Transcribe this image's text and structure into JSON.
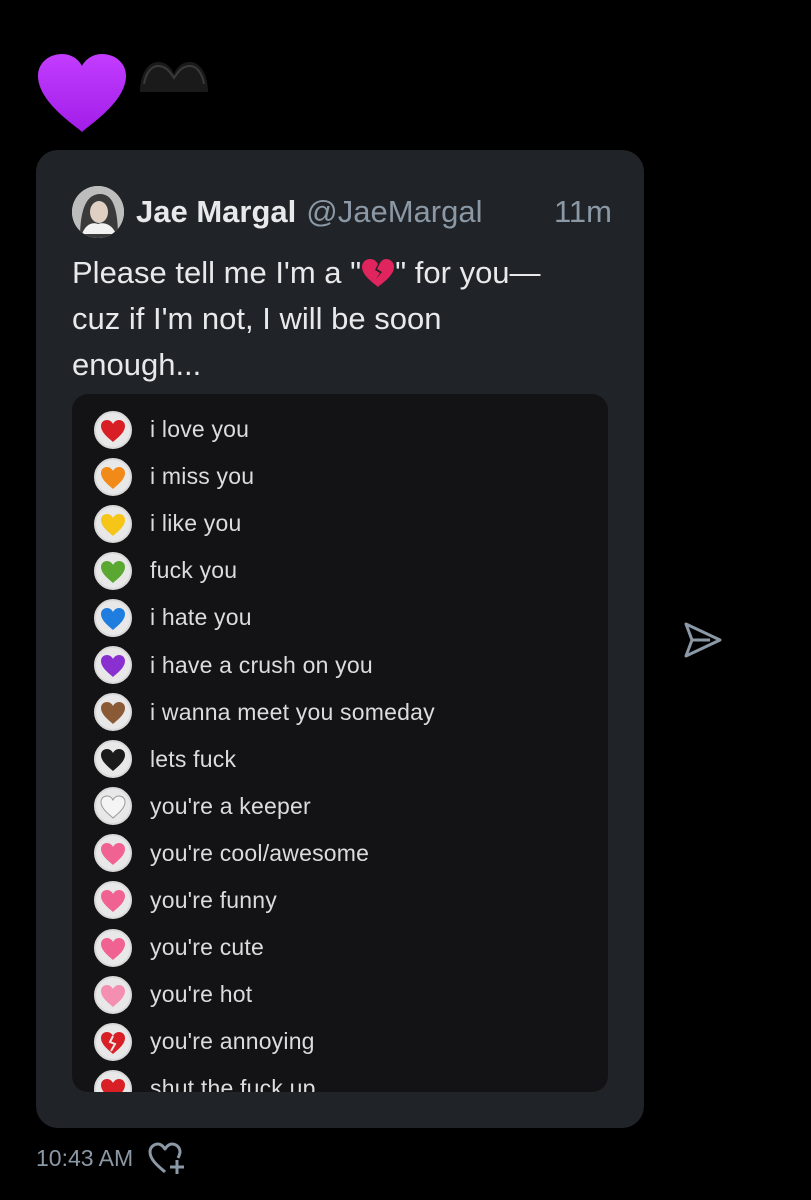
{
  "reactions": [
    {
      "icon": "purple-heart-icon",
      "color": "#b02cf5"
    },
    {
      "icon": "black-heart-icon",
      "color": "#222222"
    }
  ],
  "quoted_tweet": {
    "author": {
      "display_name": "Jae Margal",
      "handle": "@JaeMargal",
      "avatar_icon": "avatar-photo"
    },
    "time_ago": "11m",
    "text_lines": [
      "Please tell me I'm a \"",
      "\" for you—",
      "cuz if I'm not, I will be soon",
      "enough..."
    ],
    "inline_emoji": {
      "icon": "broken-heart-icon",
      "color": "#e0245e"
    },
    "media": {
      "items": [
        {
          "label": "i love you",
          "icon": "red-heart-icon",
          "color": "#d81f26"
        },
        {
          "label": "i miss you",
          "icon": "orange-heart-icon",
          "color": "#f28a1a"
        },
        {
          "label": "i like you",
          "icon": "yellow-heart-icon",
          "color": "#f5c518"
        },
        {
          "label": "fuck you",
          "icon": "green-heart-icon",
          "color": "#5aa832"
        },
        {
          "label": "i hate you",
          "icon": "blue-heart-icon",
          "color": "#1f7de0"
        },
        {
          "label": "i have a crush on you",
          "icon": "purple-heart-icon",
          "color": "#8a2fd0"
        },
        {
          "label": "i wanna meet you someday",
          "icon": "brown-heart-icon",
          "color": "#8a5a36"
        },
        {
          "label": "lets fuck",
          "icon": "black-heart-icon",
          "color": "#1b1b1b"
        },
        {
          "label": "you're a keeper",
          "icon": "white-heart-icon",
          "color": "#f4f4f4"
        },
        {
          "label": "you're cool/awesome",
          "icon": "heart-with-arrow-icon",
          "color": "#f06292"
        },
        {
          "label": "you're funny",
          "icon": "heart-with-ribbon-icon",
          "color": "#f06292"
        },
        {
          "label": "you're cute",
          "icon": "sparkling-heart-icon",
          "color": "#f06292"
        },
        {
          "label": "you're hot",
          "icon": "growing-heart-icon",
          "color": "#f48fb1"
        },
        {
          "label": "you're annoying",
          "icon": "broken-heart-icon",
          "color": "#d81f26"
        },
        {
          "label": "shut the fuck up",
          "icon": "red-heart-icon",
          "color": "#d81f26"
        }
      ]
    }
  },
  "footer": {
    "timestamp": "10:43 AM",
    "react_icon": "add-reaction-heart-icon"
  },
  "share_icon": "send-icon",
  "colors": {
    "background": "#000000",
    "card": "#202327",
    "text_primary": "#e7e9ea",
    "text_secondary": "#8b98a5"
  }
}
